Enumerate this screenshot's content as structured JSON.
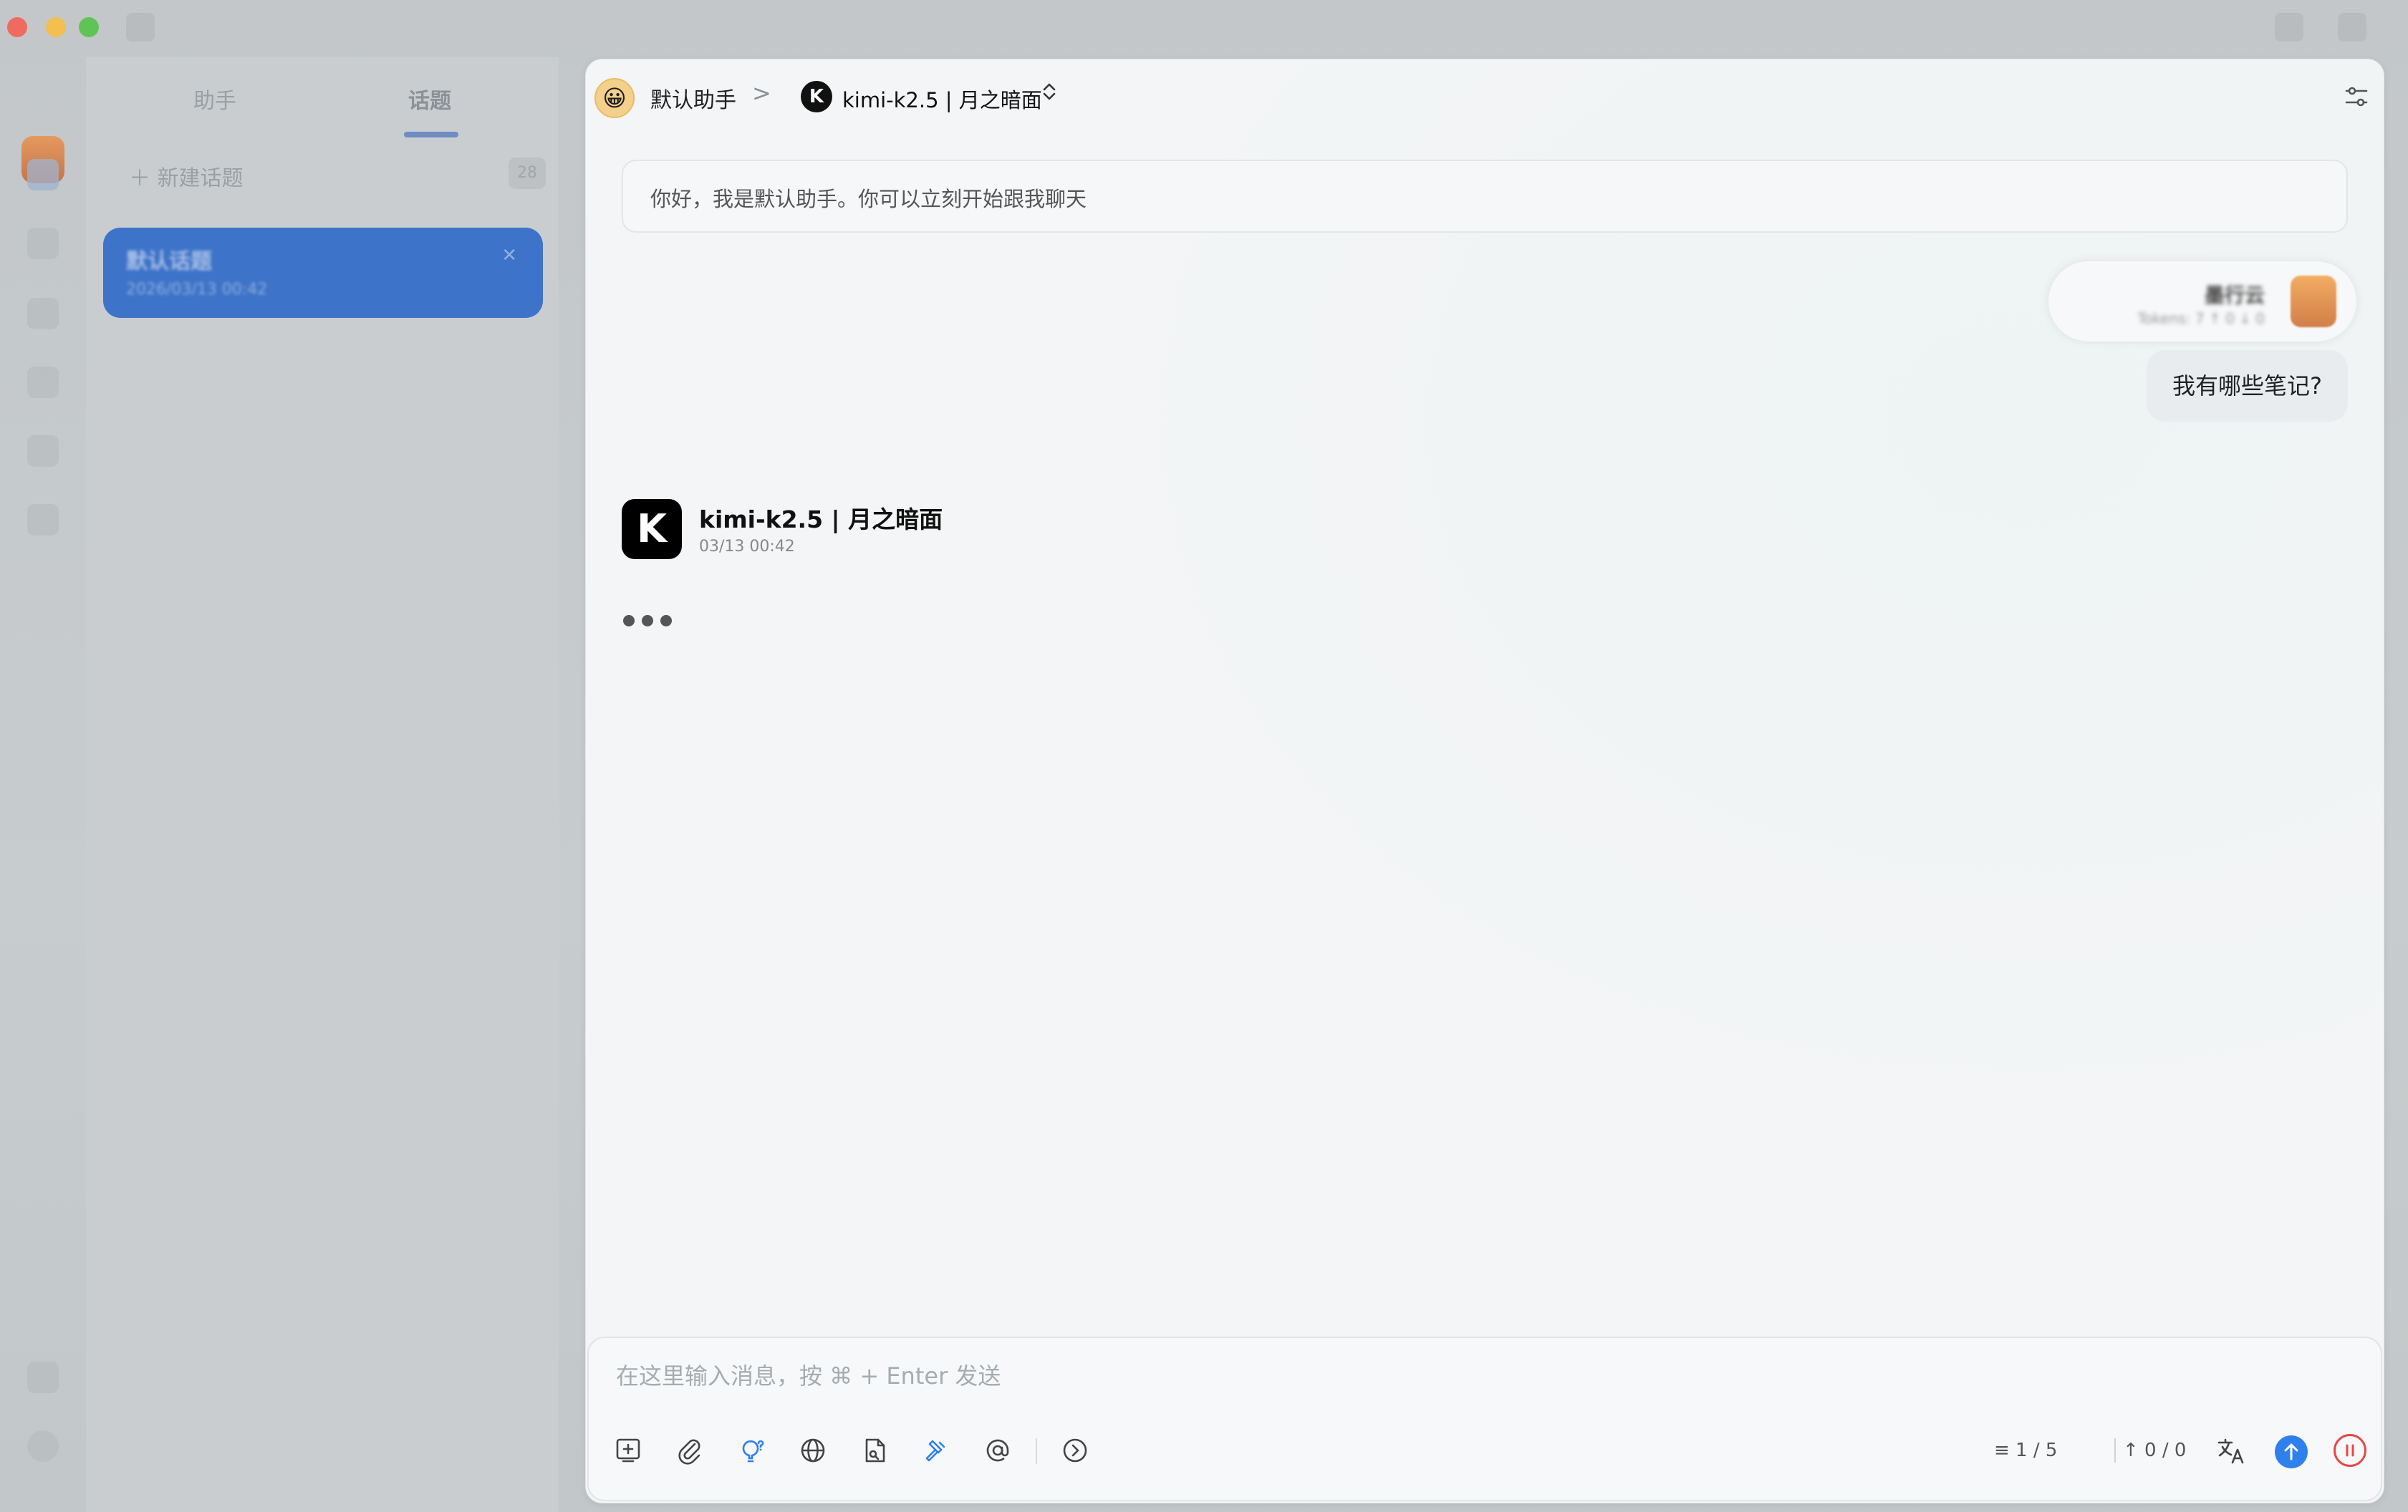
{
  "sidebar": {
    "tabs": [
      "助手",
      "话题"
    ],
    "new_topic_label": "新建话题",
    "topic_count": "28",
    "topic": {
      "title": "默认话题",
      "date": "2026/03/13 00:42"
    }
  },
  "header": {
    "assistant_emoji": "😀",
    "assistant_name": "默认助手",
    "breadcrumb_sep": ">",
    "model_icon_letter": "K",
    "model_name": "kimi-k2.5 | 月之暗面",
    "model_switch": "⌃⌄"
  },
  "chat": {
    "greeting": "你好，我是默认助手。你可以立刻开始跟我聊天",
    "user_name": "墨行云",
    "user_tokens": "Tokens: 7 ↑ 0 ↓ 0",
    "user_message": "我有哪些笔记?",
    "ai_avatar_letter": "K",
    "ai_name": "kimi-k2.5 | 月之暗面",
    "ai_time": "03/13 00:42"
  },
  "input": {
    "placeholder": "在这里输入消息，按 ⌘ + Enter 发送",
    "value": "",
    "context_counter": "≡ 1 / 5",
    "token_counter": "↑ 0 / 0"
  },
  "colors": {
    "accent": "#2f80ec",
    "selected_topic": "#3d73c9",
    "stop": "#e34848"
  }
}
